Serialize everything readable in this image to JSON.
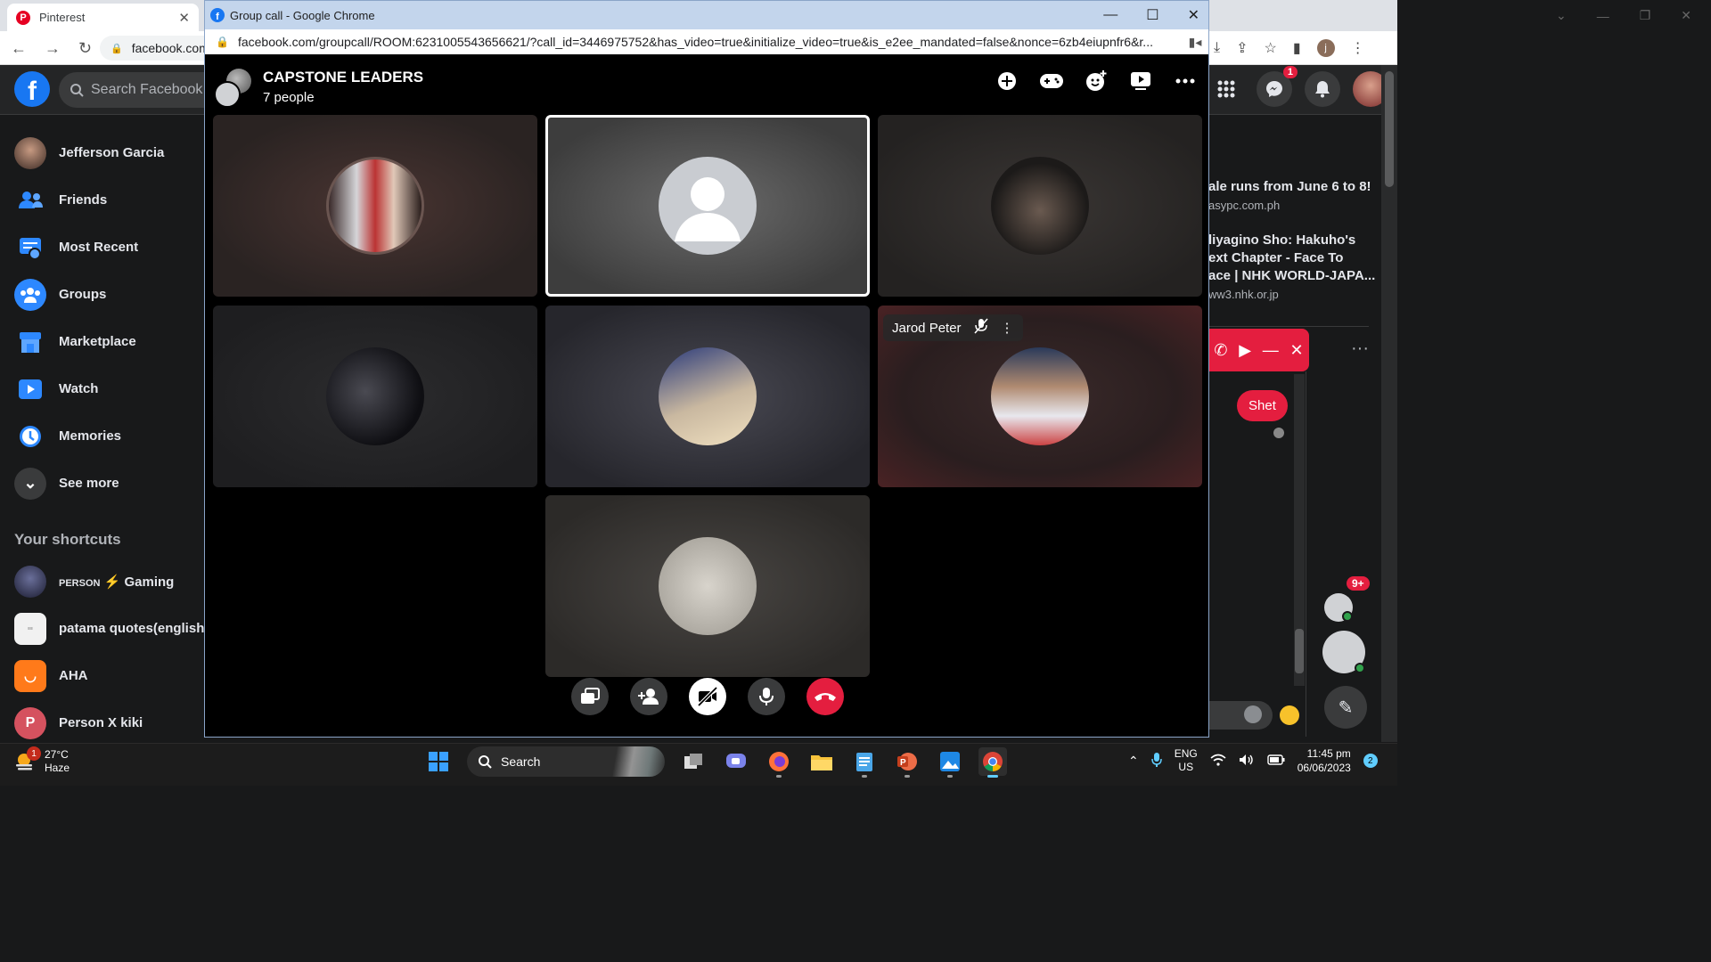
{
  "background_browser": {
    "tab_title": "Pinterest",
    "address_partial": "facebook.com",
    "profile_initial": "j"
  },
  "facebook": {
    "search_placeholder": "Search Facebook",
    "sidebar": [
      {
        "label": "Jefferson Garcia",
        "icon": "profile-avatar"
      },
      {
        "label": "Friends",
        "icon": "friends-icon"
      },
      {
        "label": "Most Recent",
        "icon": "feed-icon"
      },
      {
        "label": "Groups",
        "icon": "groups-icon"
      },
      {
        "label": "Marketplace",
        "icon": "marketplace-icon"
      },
      {
        "label": "Watch",
        "icon": "watch-icon"
      },
      {
        "label": "Memories",
        "icon": "memories-icon"
      },
      {
        "label": "See more",
        "icon": "chevron-down-icon"
      }
    ],
    "shortcuts_title": "Your shortcuts",
    "shortcuts": [
      {
        "label": "PERSON⚡ Gaming",
        "label_small": "PERSON",
        "label_rest": " Gaming"
      },
      {
        "label": "patama quotes(english,t"
      },
      {
        "label": "AHA"
      },
      {
        "label": "Person X kiki",
        "initial": "P"
      }
    ],
    "header_badges": {
      "messenger": "1"
    },
    "ads": [
      {
        "title": "ale runs from June 6 to 8!",
        "url": "asypc.com.ph"
      },
      {
        "title_lines": [
          "liyagino Sho: Hakuho's",
          "ext Chapter - Face To",
          "ace | NHK WORLD-JAPA..."
        ],
        "url": "ww3.nhk.or.jp"
      }
    ],
    "chat_message": "Shet",
    "contacts_badge": "9+"
  },
  "popup": {
    "window_title": "Group call - Google Chrome",
    "url": "facebook.com/groupcall/ROOM:6231005543656621/?call_id=3446975752&has_video=true&initialize_video=true&is_e2ee_mandated=false&nonce=6zb4eiupnfr6&r...",
    "call": {
      "title": "CAPSTONE LEADERS",
      "subtitle": "7 people",
      "participant_name_shown": "Jarod Peter"
    }
  },
  "taskbar": {
    "weather_temp": "27°C",
    "weather_desc": "Haze",
    "weather_badge": "1",
    "search_label": "Search",
    "lang_line1": "ENG",
    "lang_line2": "US",
    "time": "11:45 pm",
    "date": "06/06/2023",
    "notification_count": "2"
  },
  "colors": {
    "fb_blue": "#1877f2",
    "end_call_red": "#e41e3f",
    "taskbar_accent": "#60cdff"
  }
}
